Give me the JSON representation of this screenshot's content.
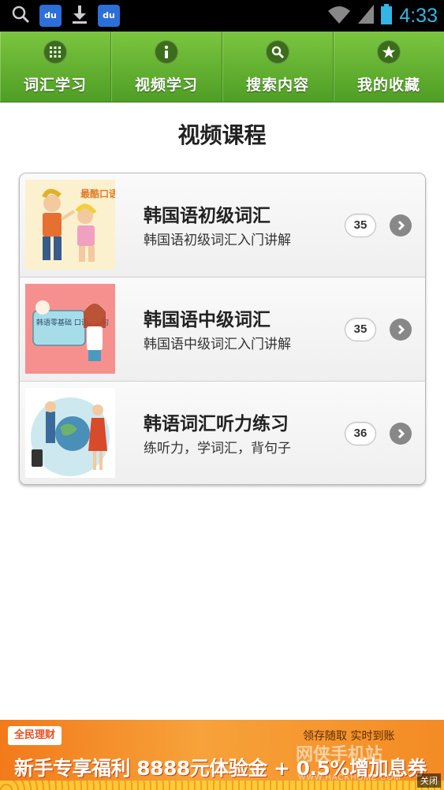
{
  "status_bar": {
    "time": "4:33",
    "left_icons": [
      "search-icon",
      "baidu-icon",
      "download-icon",
      "baidu-icon"
    ],
    "baidu_label": "du",
    "right_icons": [
      "wifi-icon",
      "signal-icon",
      "battery-icon"
    ]
  },
  "tabs": [
    {
      "label": "词汇学习",
      "icon": "grid-icon"
    },
    {
      "label": "视频学习",
      "icon": "info-icon"
    },
    {
      "label": "搜索内容",
      "icon": "search-icon"
    },
    {
      "label": "我的收藏",
      "icon": "star-icon"
    }
  ],
  "page_title": "视频课程",
  "courses": [
    {
      "title": "韩国语初级词汇",
      "description": "韩国语初级词汇入门讲解",
      "count": "35",
      "thumb_text": "最酷口语"
    },
    {
      "title": "韩国语中级词汇",
      "description": "韩国语中级词汇入门讲解",
      "count": "35",
      "thumb_text": "韩语零基础 口语100句"
    },
    {
      "title": "韩语词汇听力练习",
      "description": "练听力，学词汇，背句子",
      "count": "36",
      "thumb_text": ""
    }
  ],
  "ad": {
    "brand": "全民理财",
    "tagline": "领存随取   实时到账",
    "main_text": "新手专享福利 8888元体验金 + 0.5%增加息券",
    "watermark": "网侠手机站",
    "watermark_sub": "WWW.HACKHOME.COM",
    "close_label": "关闭"
  },
  "colors": {
    "tab_green": "#5fae2d",
    "status_time": "#33b5e5",
    "ad_orange": "#f27a1a"
  }
}
